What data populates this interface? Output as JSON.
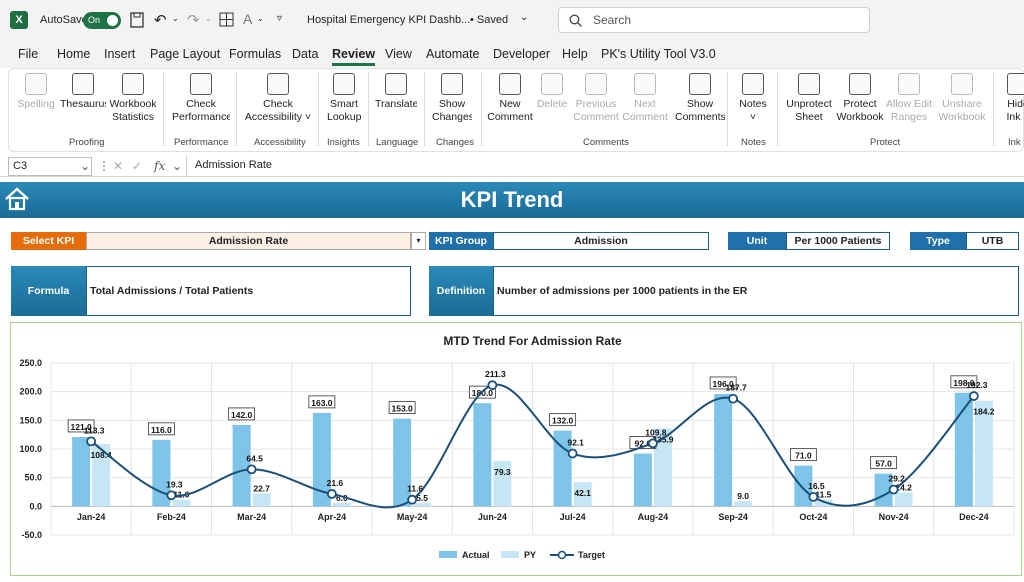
{
  "titlebar": {
    "logo": "X",
    "autosave_label": "AutoSave",
    "toggle_label": "On",
    "doc_title": "Hospital Emergency KPI Dashb...",
    "saved_label": "• Saved",
    "search_placeholder": "Search"
  },
  "menu": [
    "File",
    "Home",
    "Insert",
    "Page Layout",
    "Formulas",
    "Data",
    "Review",
    "View",
    "Automate",
    "Developer",
    "Help",
    "PK's Utility Tool V3.0"
  ],
  "menu_active": "Review",
  "ribbon": {
    "buttons": [
      {
        "label": "Spelling",
        "icon": "abc-check-icon",
        "disabled": true
      },
      {
        "label": "Thesaurus",
        "icon": "book-icon",
        "disabled": false
      },
      {
        "label": "Workbook\nStatistics",
        "icon": "grid-123-icon",
        "disabled": false
      },
      {
        "label": "Check\nPerformance",
        "icon": "grid-clock-icon",
        "disabled": false
      },
      {
        "label": "Check\nAccessibility ˅",
        "icon": "accessibility-icon",
        "disabled": false
      },
      {
        "label": "Smart\nLookup",
        "icon": "info-icon",
        "disabled": false
      },
      {
        "label": "Translate",
        "icon": "translate-icon",
        "disabled": false
      },
      {
        "label": "Show\nChanges",
        "icon": "grid-changes-icon",
        "disabled": false
      },
      {
        "label": "New\nComment",
        "icon": "new-comment-icon",
        "disabled": false
      },
      {
        "label": "Delete",
        "icon": "delete-comment-icon",
        "disabled": true
      },
      {
        "label": "Previous\nComment",
        "icon": "prev-comment-icon",
        "disabled": true
      },
      {
        "label": "Next\nComment",
        "icon": "next-comment-icon",
        "disabled": true
      },
      {
        "label": "Show\nComments",
        "icon": "show-comments-icon",
        "disabled": false
      },
      {
        "label": "Notes\n˅",
        "icon": "notes-icon",
        "disabled": false
      },
      {
        "label": "Unprotect\nSheet",
        "icon": "unprotect-sheet-icon",
        "disabled": false
      },
      {
        "label": "Protect\nWorkbook",
        "icon": "protect-workbook-icon",
        "disabled": false
      },
      {
        "label": "Allow Edit\nRanges",
        "icon": "allow-edit-icon",
        "disabled": true
      },
      {
        "label": "Unshare\nWorkbook",
        "icon": "unshare-icon",
        "disabled": true
      },
      {
        "label": "Hide\nInk ˅",
        "icon": "ink-icon",
        "disabled": false
      }
    ],
    "groups": [
      "Proofing",
      "Performance",
      "Accessibility",
      "Insights",
      "Language",
      "Changes",
      "Comments",
      "Notes",
      "Protect",
      "Ink"
    ]
  },
  "formula_bar": {
    "name_box": "C3",
    "fx": "fx",
    "content": "Admission Rate"
  },
  "dashboard": {
    "title": "KPI Trend",
    "select_kpi_label": "Select KPI",
    "select_kpi_value": "Admission Rate",
    "kpi_group_label": "KPI Group",
    "kpi_group_value": "Admission",
    "unit_label": "Unit",
    "unit_value": "Per 1000 Patients",
    "type_label": "Type",
    "type_value": "UTB",
    "formula_label": "Formula",
    "formula_value": "Total Admissions / Total Patients",
    "definition_label": "Definition",
    "definition_value": "Number of admissions per 1000 patients in the ER"
  },
  "colors": {
    "accent_green": "#1f7246",
    "select_orange": "#e46c0a",
    "label_blue": "#1f6fa8",
    "actual": "#7dc4e8",
    "py": "#c6e6f6",
    "target": "#1b4f78"
  },
  "chart_data": {
    "type": "bar",
    "title": "MTD Trend For Admission Rate",
    "categories": [
      "Jan-24",
      "Feb-24",
      "Mar-24",
      "Apr-24",
      "May-24",
      "Jun-24",
      "Jul-24",
      "Aug-24",
      "Sep-24",
      "Oct-24",
      "Nov-24",
      "Dec-24"
    ],
    "series": [
      {
        "name": "Actual",
        "type": "bar",
        "values": [
          121.0,
          116.0,
          142.0,
          163.0,
          153.0,
          180.0,
          132.0,
          92.0,
          196.0,
          71.0,
          57.0,
          198.0
        ]
      },
      {
        "name": "PY",
        "type": "bar",
        "values": [
          108.4,
          11.6,
          22.7,
          6.0,
          5.5,
          79.3,
          42.1,
          135.9,
          9.0,
          11.5,
          24.2,
          184.2
        ]
      },
      {
        "name": "Target",
        "type": "line",
        "values": [
          113.3,
          19.3,
          64.5,
          21.6,
          11.6,
          211.3,
          92.1,
          109.8,
          187.7,
          16.5,
          29.2,
          192.3
        ]
      }
    ],
    "ylim": [
      -50,
      250
    ],
    "yticks": [
      "250.0",
      "200.0",
      "150.0",
      "100.0",
      "50.0",
      "0.0",
      "-50.0"
    ],
    "grid": true,
    "legend": "bottom"
  }
}
